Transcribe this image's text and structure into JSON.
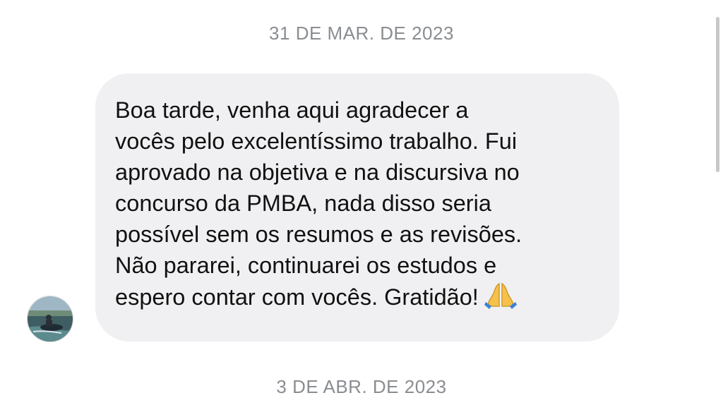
{
  "conversation": {
    "date_top": "31 DE MAR. DE 2023",
    "message": {
      "text": "Boa tarde, venha aqui agradecer a\nvocês pelo excelentíssimo trabalho. Fui\naprovado na objetiva e na discursiva no\nconcurso da PMBA, nada disso seria\npossível sem os resumos e as revisões.\nNão pararei, continuarei os estudos e\nespero contar com vocês. Gratidão!",
      "emoji": "folded-hands-icon"
    },
    "date_bottom": "3 DE ABR. DE 2023"
  },
  "colors": {
    "bubble": "#f0f0f2",
    "date_text": "#8a8d91",
    "message_text": "#111111"
  }
}
